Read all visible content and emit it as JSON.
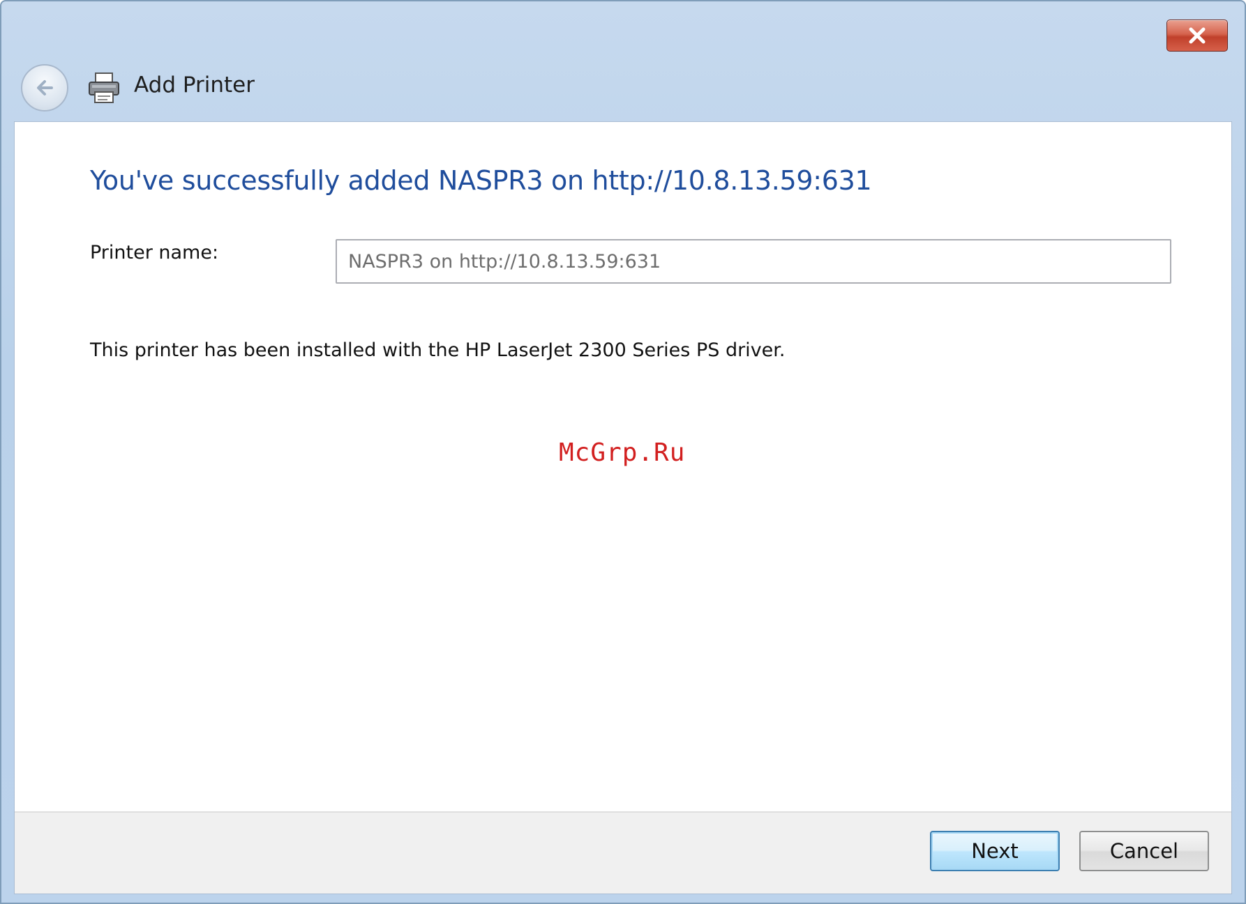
{
  "window": {
    "title": "Add Printer",
    "close_icon": "close-icon",
    "back_icon": "back-arrow-icon",
    "app_icon": "printer-icon"
  },
  "main": {
    "heading": "You've successfully added NASPR3 on http://10.8.13.59:631",
    "printer_name_label": "Printer name:",
    "printer_name_value": "NASPR3 on http://10.8.13.59:631",
    "driver_note": "This printer has been installed with the HP LaserJet 2300 Series PS driver."
  },
  "watermark": "McGrp.Ru",
  "footer": {
    "next_label": "Next",
    "cancel_label": "Cancel"
  },
  "colors": {
    "heading": "#1f4d9c",
    "titlebar": "#c6d9ee",
    "close_button": "#c0402b",
    "watermark": "#d21f1f"
  }
}
